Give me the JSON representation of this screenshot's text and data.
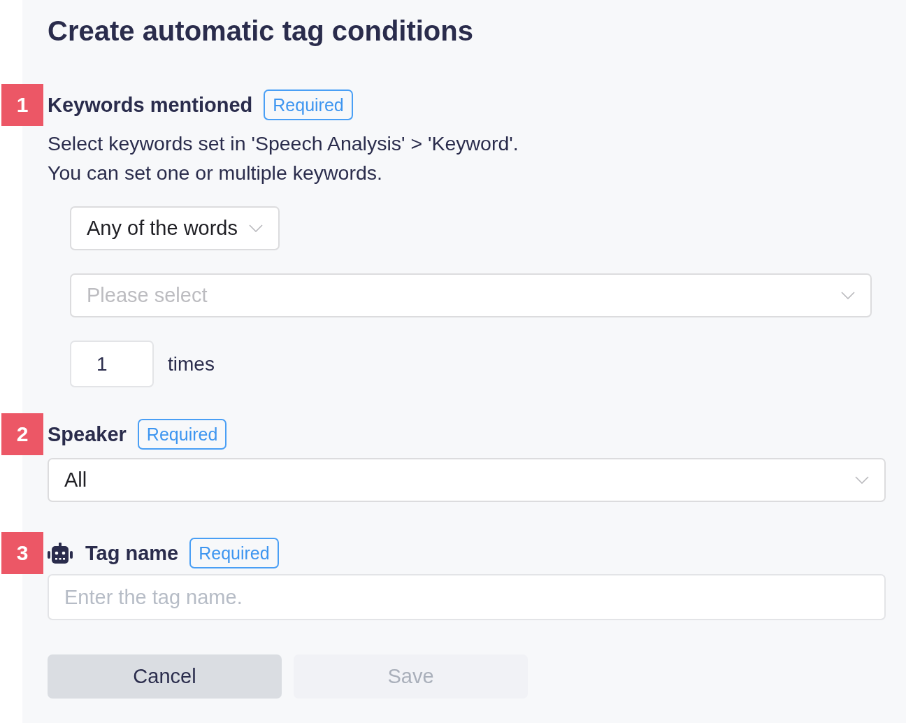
{
  "title": "Create automatic tag conditions",
  "sections": [
    {
      "marker": "1",
      "kind": "keywords",
      "has_icon": false,
      "heading": "Keywords mentioned",
      "badge": "Required",
      "description": [
        "Select keywords set in 'Speech Analysis' > 'Keyword'.",
        "You can set one or multiple keywords."
      ],
      "match_mode": {
        "value": "Any of the words"
      },
      "keyword_select": {
        "placeholder": "Please select"
      },
      "count": {
        "value": "1",
        "unit": "times"
      }
    },
    {
      "marker": "2",
      "kind": "select",
      "has_icon": false,
      "heading": "Speaker",
      "badge": "Required",
      "field": {
        "value": "All"
      }
    },
    {
      "marker": "3",
      "kind": "text",
      "has_icon": true,
      "heading": "Tag name",
      "badge": "Required",
      "field": {
        "placeholder": "Enter the tag name."
      }
    }
  ],
  "buttons": [
    {
      "label": "Cancel",
      "disabled": false
    },
    {
      "label": "Save",
      "disabled": true
    }
  ]
}
